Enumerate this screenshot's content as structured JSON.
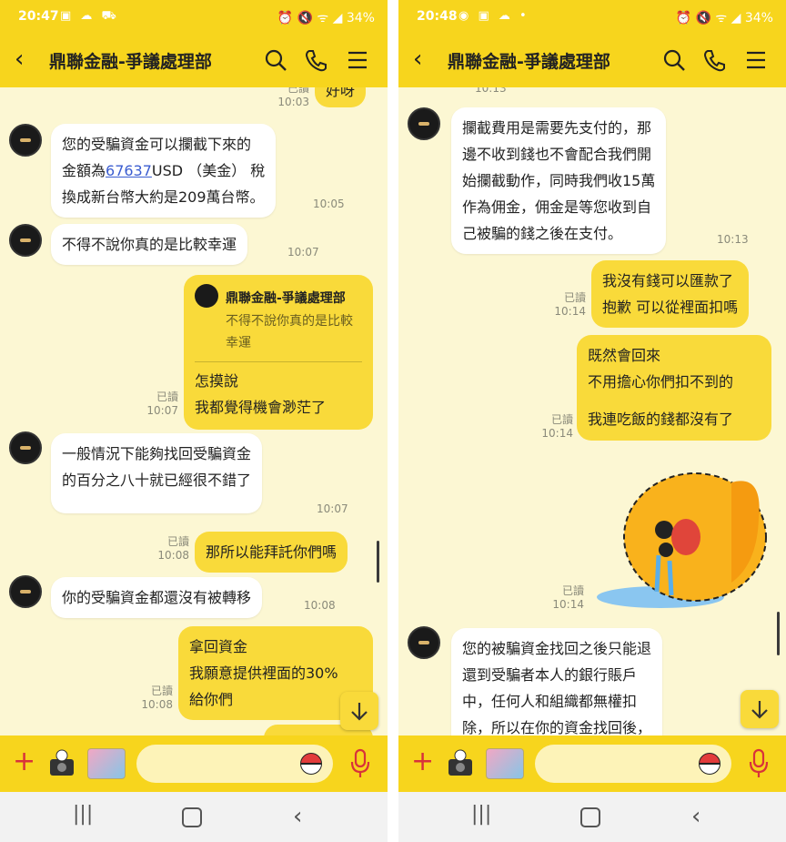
{
  "left": {
    "status": {
      "time": "20:47",
      "icons": "▣ ☁ ⛟",
      "right": "⏰ 🔇 ᯤ ◢ 34%"
    },
    "header": {
      "title": "鼎聯金融-爭議處理部"
    },
    "messages": {
      "m0": {
        "text": "好呀",
        "read": "已讀",
        "time": "10:03"
      },
      "m1": {
        "l1": "您的受騙資金可以攔截下來的",
        "l2a": "金額為",
        "l2b": "67637",
        "l2c": "USD （美金） 稅",
        "l3": "換成新台幣大約是209萬台幣。",
        "time": "10:05"
      },
      "m2": {
        "text": "不得不說你真的是比較幸運",
        "time": "10:07"
      },
      "m3": {
        "reply_name": "鼎聯金融-爭議處理部",
        "reply_text": "不得不說你真的是比較幸運",
        "l1": "怎摸說",
        "l2": "我都覺得機會渺茫了",
        "read": "已讀",
        "time": "10:07"
      },
      "m4": {
        "l1": "一般情況下能夠找回受騙資金",
        "l2": "的百分之八十就已經很不錯了",
        "time": "10:07"
      },
      "m5": {
        "text": "那所以能拜託你們嗎",
        "read": "已讀",
        "time": "10:08"
      },
      "m6": {
        "text": "你的受騙資金都還沒有被轉移",
        "time": "10:08"
      },
      "m7": {
        "l1": "拿回資金",
        "l2": "我願意提供裡面的30%",
        "l3": "給你們",
        "read": "已讀",
        "time": "10:08"
      }
    }
  },
  "right": {
    "status": {
      "time": "20:48",
      "icons": "◉ ▣ ☁ •",
      "right": "⏰ 🔇 ᯤ ◢ 34%"
    },
    "header": {
      "title": "鼎聯金融-爭議處理部"
    },
    "messages": {
      "m0": {
        "time": "10:13"
      },
      "m1": {
        "l1": "攔截費用是需要先支付的，那",
        "l2": "邊不收到錢也不會配合我們開",
        "l3": "始攔截動作，同時我們收15萬",
        "l4": "作為佣金，佣金是等您收到自",
        "l5": "己被騙的錢之後在支付。",
        "time": "10:13"
      },
      "m2": {
        "l1": "我沒有錢可以匯款了",
        "l2": "抱歉 可以從裡面扣嗎",
        "read": "已讀",
        "time": "10:14"
      },
      "m3": {
        "l1": "既然會回來",
        "l2": "不用擔心你們扣不到的",
        "l3": "我連吃飯的錢都沒有了",
        "read": "已讀",
        "time": "10:14"
      },
      "m4": {
        "read": "已讀",
        "time": "10:14"
      },
      "m5": {
        "l1": "您的被騙資金找回之後只能退",
        "l2": "還到受騙者本人的銀行賬戶",
        "l3": "中，任何人和組織都無權扣",
        "l4": "除，所以在你的資金找回後，"
      }
    }
  },
  "icons": {
    "back": "chevron-left-icon",
    "search": "search-icon",
    "call": "phone-icon",
    "menu": "menu-icon",
    "plus": "plus-icon",
    "mic": "mic-icon",
    "scroll": "arrow-down-icon"
  },
  "colors": {
    "header": "#f7d51d",
    "background": "#fcf7d3",
    "outgoing": "#f9da3a",
    "incoming": "#ffffff",
    "accent": "#d8323a"
  }
}
